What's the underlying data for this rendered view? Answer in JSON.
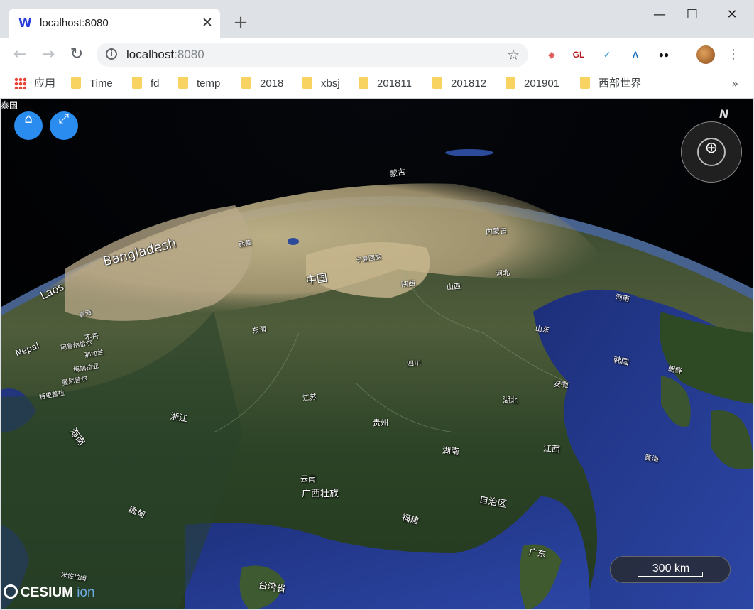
{
  "browser": {
    "tab_title": "localhost:8080",
    "tab_favicon": "W",
    "tab_close": "✕",
    "new_tab": "+",
    "window_controls": {
      "minimize": "—",
      "maximize": "☐",
      "close": "✕"
    },
    "url_host": "localhost",
    "url_port": ":8080",
    "extensions": [
      {
        "icon": "cube-extension-icon",
        "label": "◈",
        "color": "#d9534f"
      },
      {
        "icon": "gl-extension-icon",
        "label": "GL",
        "color": "#b71c1c"
      },
      {
        "icon": "check-extension-icon",
        "label": "✓",
        "color": "#4ea6dc"
      },
      {
        "icon": "lambda-extension-icon",
        "label": "Λ",
        "color": "#1e73be"
      },
      {
        "icon": "owl-extension-icon",
        "label": "●●",
        "color": "#111111"
      }
    ],
    "bookmarks": {
      "apps_label": "应用",
      "items": [
        "Time",
        "fd",
        "temp",
        "2018",
        "xbsj",
        "201811",
        "201812",
        "201901",
        "西部世界"
      ],
      "more": "»"
    }
  },
  "map": {
    "labels": [
      {
        "text": "蒙古",
        "size": 11
      },
      {
        "text": "内蒙古",
        "size": 10
      },
      {
        "text": "宁夏回族",
        "size": 9
      },
      {
        "text": "中国",
        "size": 15
      },
      {
        "text": "陕西",
        "size": 10
      },
      {
        "text": "山西",
        "size": 10
      },
      {
        "text": "河北",
        "size": 10
      },
      {
        "text": "山东",
        "size": 10
      },
      {
        "text": "河南",
        "size": 10
      },
      {
        "text": "朝鲜",
        "size": 10
      },
      {
        "text": "韩国",
        "size": 11
      },
      {
        "text": "黄海",
        "size": 10
      },
      {
        "text": "东海",
        "size": 10
      },
      {
        "text": "四川",
        "size": 10
      },
      {
        "text": "湖北",
        "size": 11
      },
      {
        "text": "安徽",
        "size": 11
      },
      {
        "text": "江苏",
        "size": 10
      },
      {
        "text": "贵州",
        "size": 11
      },
      {
        "text": "湖南",
        "size": 12
      },
      {
        "text": "江西",
        "size": 12
      },
      {
        "text": "浙江",
        "size": 12
      },
      {
        "text": "云南",
        "size": 11
      },
      {
        "text": "广西壮族",
        "size": 13
      },
      {
        "text": "自治区",
        "size": 13
      },
      {
        "text": "福建",
        "size": 12
      },
      {
        "text": "广东",
        "size": 12
      },
      {
        "text": "台湾省",
        "size": 13
      },
      {
        "text": "海南",
        "size": 13
      },
      {
        "text": "缅甸",
        "size": 12
      },
      {
        "text": "Laos",
        "size": 15
      },
      {
        "text": "Nepal",
        "size": 12
      },
      {
        "text": "Bangladesh",
        "size": 18
      },
      {
        "text": "西藏",
        "size": 9
      },
      {
        "text": "青海",
        "size": 9
      },
      {
        "text": "不丹",
        "size": 10
      },
      {
        "text": "阿鲁纳恰尔",
        "size": 9
      },
      {
        "text": "那加兰",
        "size": 9
      },
      {
        "text": "梅加拉亚",
        "size": 9
      },
      {
        "text": "曼尼普尔",
        "size": 9
      },
      {
        "text": "特里普拉",
        "size": 9
      },
      {
        "text": "米佐拉姆",
        "size": 9
      },
      {
        "text": "泰国",
        "size": 12
      }
    ],
    "compass_north": "N",
    "scale_label": "300 km",
    "logo_main": "CESIUM",
    "logo_ion": "ion",
    "home_icon": "⌂",
    "fullscreen_icon": "⤢"
  }
}
